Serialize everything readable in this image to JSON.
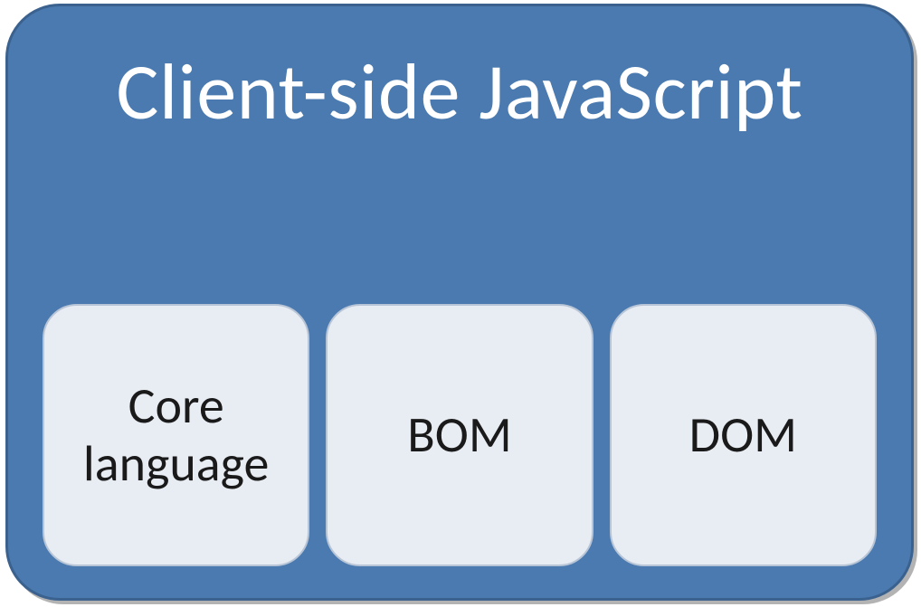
{
  "diagram": {
    "title": "Client-side JavaScript",
    "boxes": {
      "box1": "Core language",
      "box2": "BOM",
      "box3": "DOM"
    },
    "colors": {
      "containerBg": "#4a7ab0",
      "containerBorder": "#3b628f",
      "boxBg": "#e8ecf3",
      "boxBorder": "#b8c5d6",
      "titleColor": "#ffffff",
      "boxTextColor": "#1a1a1a"
    }
  }
}
